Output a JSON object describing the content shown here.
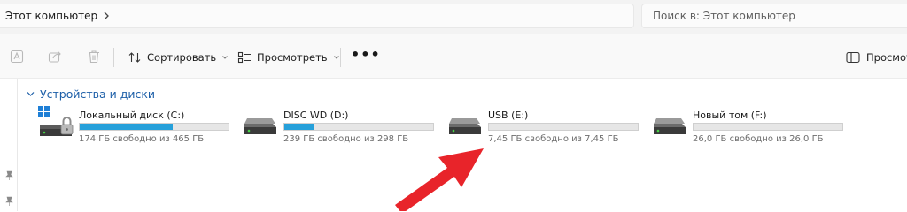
{
  "address_bar": {
    "path": "Этот компьютер"
  },
  "search": {
    "placeholder": "Поиск в: Этот компьютер"
  },
  "toolbar": {
    "sort_label": "Сортировать",
    "view_label": "Просмотреть",
    "more_label": "•••",
    "preview_label": "Просмотр"
  },
  "group": {
    "title": "Устройства и диски"
  },
  "drives": [
    {
      "name": "Локальный диск (C:)",
      "free_text": "174 ГБ свободно из 465 ГБ",
      "used_fraction": 0.626,
      "icon": "system-drive-locked-icon"
    },
    {
      "name": "DISC WD (D:)",
      "free_text": "239 ГБ свободно из 298 ГБ",
      "used_fraction": 0.198,
      "icon": "hard-drive-icon"
    },
    {
      "name": "USB (E:)",
      "free_text": "7,45 ГБ свободно из 7,45 ГБ",
      "used_fraction": 0.0,
      "icon": "hard-drive-icon"
    },
    {
      "name": "Новый том (F:)",
      "free_text": "26,0 ГБ свободно из 26,0 ГБ",
      "used_fraction": 0.0,
      "icon": "hard-drive-icon"
    }
  ],
  "colors": {
    "accent": "#26a0da",
    "group_title": "#1d5fa8",
    "annotation_arrow": "#e8242a"
  }
}
